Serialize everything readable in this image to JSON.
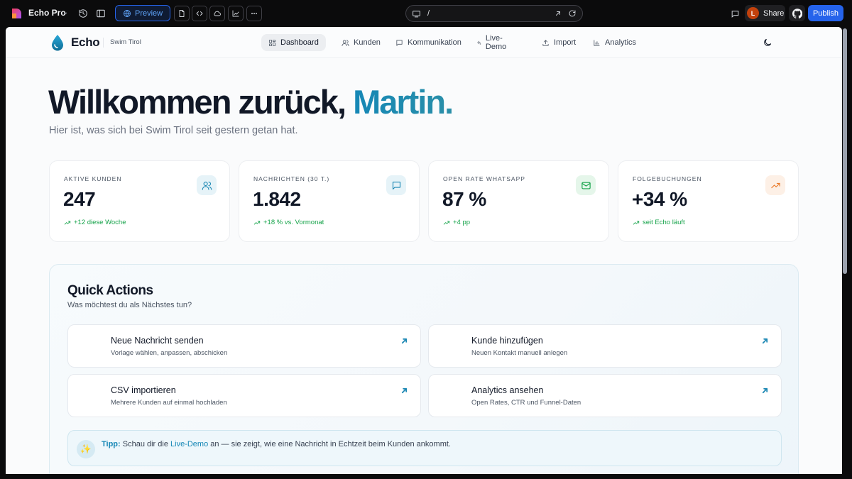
{
  "browser": {
    "app_name": "Echo Pro",
    "preview_label": "Preview",
    "url_path": "/",
    "share_label": "Share",
    "avatar_initial": "L",
    "publish_label": "Publish"
  },
  "header": {
    "brand": "Echo",
    "subtitle": "Swim Tirol",
    "nav": [
      {
        "label": "Dashboard",
        "icon": "dashboard-icon",
        "active": true
      },
      {
        "label": "Kunden",
        "icon": "users-icon"
      },
      {
        "label": "Kommunikation",
        "icon": "message-icon"
      },
      {
        "label": "Live-Demo",
        "icon": "sparkles-icon"
      },
      {
        "label": "Import",
        "icon": "upload-icon"
      },
      {
        "label": "Analytics",
        "icon": "bar-chart-icon"
      }
    ]
  },
  "hero": {
    "title_prefix": "Willkommen zurück, ",
    "title_name": "Martin.",
    "subtitle": "Hier ist, was sich bei Swim Tirol seit gestern getan hat."
  },
  "stats": [
    {
      "label": "AKTIVE KUNDEN",
      "value": "247",
      "delta": "+12 diese Woche",
      "icon": "users-icon",
      "icon_color": "#1d88b4",
      "icon_bg": "#e6f3f8"
    },
    {
      "label": "NACHRICHTEN (30 T.)",
      "value": "1.842",
      "delta": "+18 % vs. Vormonat",
      "icon": "message-icon",
      "icon_color": "#1d88b4",
      "icon_bg": "#e6f3f8"
    },
    {
      "label": "OPEN RATE WHATSAPP",
      "value": "87 %",
      "delta": "+4 pp",
      "icon": "mail-icon",
      "icon_color": "#16a34a",
      "icon_bg": "#e5f6ea"
    },
    {
      "label": "FOLGEBUCHUNGEN",
      "value": "+34 %",
      "delta": "seit Echo läuft",
      "icon": "trending-up-icon",
      "icon_color": "#ea7a2a",
      "icon_bg": "#fdf0e6"
    }
  ],
  "quick_actions": {
    "title": "Quick Actions",
    "subtitle": "Was möchtest du als Nächstes tun?",
    "items": [
      {
        "title": "Neue Nachricht senden",
        "desc": "Vorlage wählen, anpassen, abschicken"
      },
      {
        "title": "Kunde hinzufügen",
        "desc": "Neuen Kontakt manuell anlegen"
      },
      {
        "title": "CSV importieren",
        "desc": "Mehrere Kunden auf einmal hochladen"
      },
      {
        "title": "Analytics ansehen",
        "desc": "Open Rates, CTR und Funnel-Daten"
      }
    ],
    "tip": {
      "label": "Tipp:",
      "before": " Schau dir die ",
      "link": "Live-Demo",
      "after": " an — sie zeigt, wie eine Nachricht in Echtzeit beim Kunden ankommt."
    }
  },
  "colors": {
    "accent": "#1d88b4",
    "publish": "#2563eb",
    "positive": "#16a34a"
  }
}
